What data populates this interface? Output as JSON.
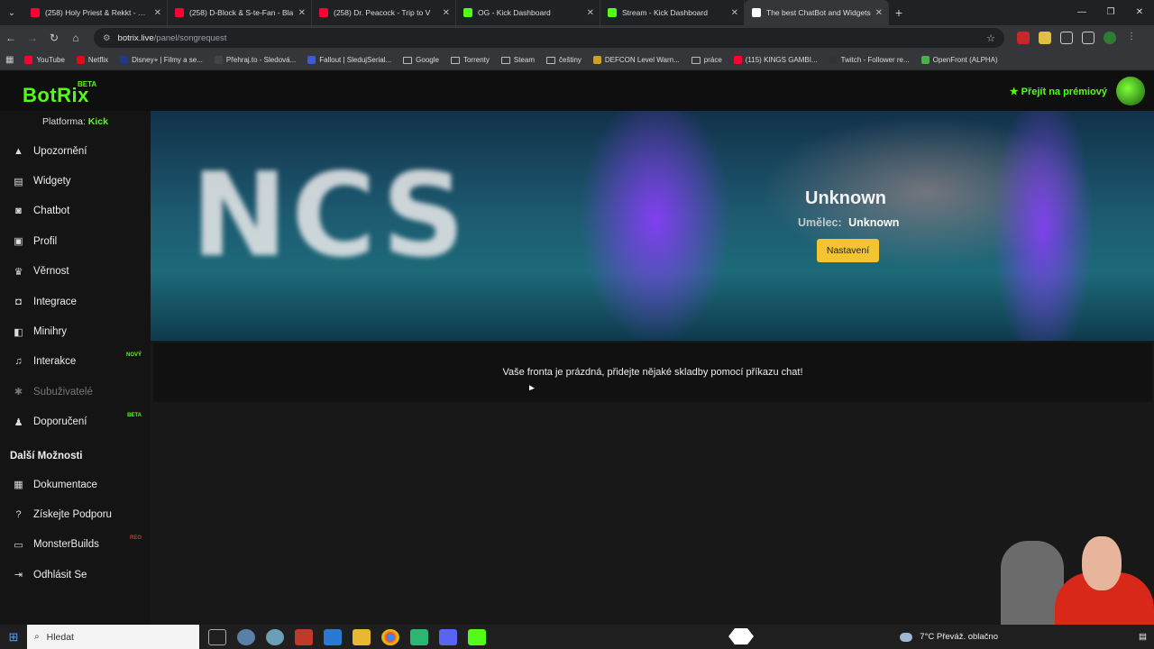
{
  "browser": {
    "tabs": [
      {
        "title": "(258) Holy Priest & Rekkt - DOI",
        "color": "#ff0033"
      },
      {
        "title": "(258) D-Block & S-te-Fan - Bla",
        "color": "#ff0033"
      },
      {
        "title": "(258) Dr. Peacock - Trip to V",
        "color": "#ff0033"
      },
      {
        "title": "OG - Kick Dashboard",
        "color": "#53fc18"
      },
      {
        "title": "Stream - Kick Dashboard",
        "color": "#53fc18"
      },
      {
        "title": "The best ChatBot and Widgets",
        "color": "#ffffff"
      }
    ],
    "url_host": "botrix.live",
    "url_path": "/panel/songrequest",
    "bookmarks": [
      {
        "label": "YouTube",
        "type": "site",
        "color": "#ff0033"
      },
      {
        "label": "Netflix",
        "type": "site",
        "color": "#e50914"
      },
      {
        "label": "Disney+ | Filmy a se...",
        "type": "site",
        "color": "#1e3a8a"
      },
      {
        "label": "Přehraj.to - Sledová...",
        "type": "site",
        "color": "#444444"
      },
      {
        "label": "Fallout | SledujSerial...",
        "type": "site",
        "color": "#3b5bdb"
      },
      {
        "label": "Google",
        "type": "folder"
      },
      {
        "label": "Torrenty",
        "type": "folder"
      },
      {
        "label": "Steam",
        "type": "folder"
      },
      {
        "label": "češtiny",
        "type": "folder"
      },
      {
        "label": "DEFCON Level Warn...",
        "type": "site",
        "color": "#c9a227"
      },
      {
        "label": "práce",
        "type": "folder"
      },
      {
        "label": "(115) KINGS GAMBI...",
        "type": "site",
        "color": "#ff0033"
      },
      {
        "label": "Twitch - Follower re...",
        "type": "site",
        "color": "#333333"
      },
      {
        "label": "OpenFront (ALPHA)",
        "type": "site",
        "color": "#4caf50"
      }
    ]
  },
  "app": {
    "logo": "BotRix",
    "logo_badge": "BETA",
    "premium_label": "Přejít na prémiový",
    "accent": "#53fc18"
  },
  "sidebar": {
    "platform_label": "Platforma:",
    "platform_value": "Kick",
    "items": [
      {
        "label": "Upozornění",
        "icon": "warning-icon",
        "glyph": "▲",
        "tag": "",
        "disabled": false
      },
      {
        "label": "Widgety",
        "icon": "widgets-icon",
        "glyph": "▤",
        "tag": "",
        "disabled": false
      },
      {
        "label": "Chatbot",
        "icon": "robot-icon",
        "glyph": "◙",
        "tag": "",
        "disabled": false
      },
      {
        "label": "Profil",
        "icon": "profile-card-icon",
        "glyph": "▣",
        "tag": "",
        "disabled": false
      },
      {
        "label": "Věrnost",
        "icon": "trophy-icon",
        "glyph": "♛",
        "tag": "",
        "disabled": false
      },
      {
        "label": "Integrace",
        "icon": "integration-icon",
        "glyph": "◘",
        "tag": "",
        "disabled": false
      },
      {
        "label": "Minihry",
        "icon": "games-icon",
        "glyph": "◧",
        "tag": "",
        "disabled": false
      },
      {
        "label": "Interakce",
        "icon": "music-note-icon",
        "glyph": "♫",
        "tag": "NOVÝ",
        "tag_color": "#53fc18",
        "disabled": false
      },
      {
        "label": "Subuživatelé",
        "icon": "users-icon",
        "glyph": "✱",
        "tag": "",
        "disabled": true
      },
      {
        "label": "Doporučení",
        "icon": "referral-icon",
        "glyph": "♟",
        "tag": "BETA",
        "tag_color": "#53fc18",
        "disabled": false
      }
    ],
    "more_heading": "Další Možnosti",
    "more_items": [
      {
        "label": "Dokumentace",
        "icon": "docs-icon",
        "glyph": "▦",
        "tag": ""
      },
      {
        "label": "Získejte Podporu",
        "icon": "help-icon",
        "glyph": "?",
        "tag": ""
      },
      {
        "label": "MonsterBuilds",
        "icon": "laptop-icon",
        "glyph": "▭",
        "tag": "REO",
        "tag_color": "#d32f2f"
      },
      {
        "label": "Odhlásit Se",
        "icon": "logout-icon",
        "glyph": "⇥",
        "tag": ""
      }
    ]
  },
  "player": {
    "cover_text": "NCS",
    "title": "Unknown",
    "artist_label": "Umělec:",
    "artist": "Unknown",
    "settings_button": "Nastavení"
  },
  "queue": {
    "empty_message": "Vaše fronta je prázdná, přidejte nějaké skladby pomocí příkazu chat!"
  },
  "taskbar": {
    "search_placeholder": "Hledat",
    "weather": "7°C  Převáž. oblačno"
  }
}
